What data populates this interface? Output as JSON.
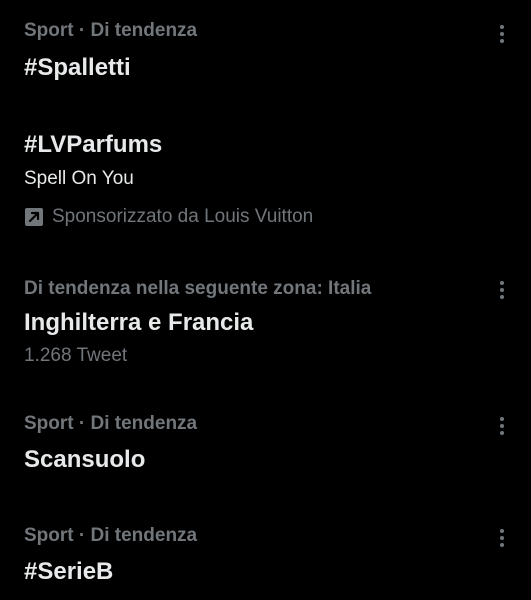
{
  "trends": [
    {
      "meta": "Sport · Di tendenza",
      "title": "#Spalletti"
    },
    {
      "title": "#LVParfums",
      "subtitle": "Spell On You",
      "promoted": "Sponsorizzato da Louis Vuitton"
    },
    {
      "meta": "Di tendenza nella seguente zona: Italia",
      "title": "Inghilterra e Francia",
      "count": "1.268 Tweet"
    },
    {
      "meta": "Sport · Di tendenza",
      "title": "Scansuolo"
    },
    {
      "meta": "Sport · Di tendenza",
      "title": "#SerieB"
    }
  ],
  "icons": {
    "more": "more-dots-icon",
    "promoted": "promoted-arrow-icon"
  },
  "colors": {
    "background": "#000000",
    "primary_text": "#e7e9ea",
    "secondary_text": "#71767b"
  }
}
